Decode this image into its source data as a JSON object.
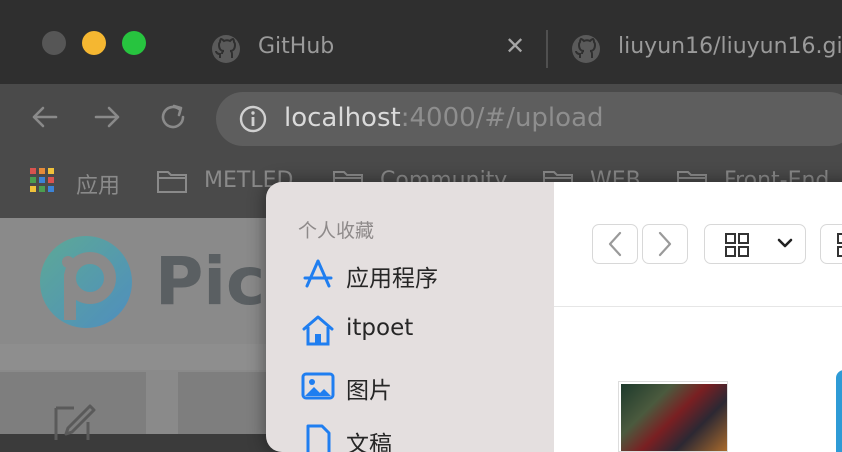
{
  "colors": {
    "traffic_close": "#565656",
    "traffic_minimize": "#f5b731",
    "traffic_maximize": "#27c43f",
    "sidebar_icon_blue": "#1f7ef0",
    "logo_green": "#4eb39a",
    "logo_blue": "#3b8fd0"
  },
  "browser": {
    "tabs": [
      {
        "icon": "github-icon",
        "title": "GitHub"
      },
      {
        "icon": "github-icon",
        "title": "liuyun16/liuyun16.gi"
      }
    ],
    "address": {
      "host": "localhost",
      "rest": ":4000/#/upload"
    },
    "bookmarks": [
      {
        "icon": "apps-grid-icon",
        "label": "应用"
      },
      {
        "icon": "folder-icon",
        "label": "METLED"
      },
      {
        "icon": "folder-icon",
        "label": "Community"
      },
      {
        "icon": "folder-icon",
        "label": "WEB"
      },
      {
        "icon": "folder-icon",
        "label": "Front-End"
      }
    ]
  },
  "page": {
    "logo_text": "PicX"
  },
  "dialog": {
    "sidebar": {
      "heading": "个人收藏",
      "items": [
        {
          "icon": "applications-icon",
          "label": "应用程序"
        },
        {
          "icon": "home-icon",
          "label": "itpoet"
        },
        {
          "icon": "pictures-icon",
          "label": "图片"
        },
        {
          "icon": "document-icon",
          "label": "文稿"
        }
      ]
    },
    "toolbar": {
      "view_mode": "grid-view-icon"
    }
  }
}
